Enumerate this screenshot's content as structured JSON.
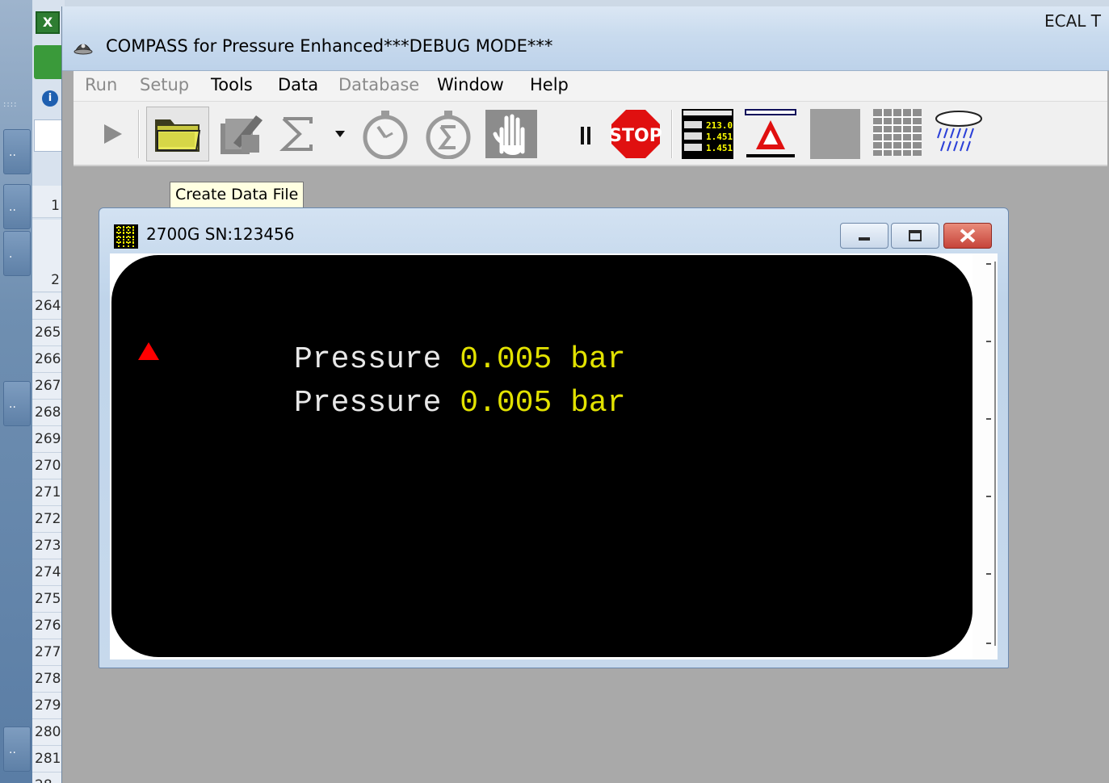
{
  "background_app": {
    "excel_icon_letter": "X",
    "info_icon": "info-icon",
    "title_fragment": "ECAL T",
    "row_headers": [
      "1",
      "2",
      "264",
      "265",
      "266",
      "267",
      "268",
      "269",
      "270",
      "271",
      "272",
      "273",
      "274",
      "275",
      "276",
      "277",
      "278",
      "279",
      "280",
      "281",
      "28"
    ]
  },
  "app": {
    "title": "COMPASS for Pressure Enhanced***DEBUG MODE***",
    "title_icon": "compass-app-icon"
  },
  "menu": [
    {
      "label": "Run",
      "enabled": false
    },
    {
      "label": "Setup",
      "enabled": false
    },
    {
      "label": "Tools",
      "enabled": true
    },
    {
      "label": "Data",
      "enabled": true
    },
    {
      "label": "Database",
      "enabled": false
    },
    {
      "label": "Window",
      "enabled": true
    },
    {
      "label": "Help",
      "enabled": true
    }
  ],
  "toolbar": {
    "items": [
      "run-play-icon",
      "open-folder-icon",
      "edit-document-icon",
      "sigma-icon",
      "dropdown-arrow-icon",
      "stopwatch-icon",
      "stopwatch-sum-icon",
      "hand-stop-icon",
      "pause-icon",
      "stop-sign-icon",
      "readout-display-icon",
      "alarm-triangle-icon",
      "gray-block-icon",
      "grid-icon",
      "rain-cloud-icon"
    ],
    "stop_label": "STOP",
    "readout_icon_values": [
      "213.0",
      "1.451",
      "1.451"
    ]
  },
  "tooltip": {
    "text": "Create Data File"
  },
  "child_window": {
    "title": "2700G SN:123456",
    "title_icon": "device-grid-icon"
  },
  "display": {
    "readings": [
      {
        "label": "Pressure",
        "value": "0.005",
        "unit": "bar"
      },
      {
        "label": "Pressure",
        "value": "0.005",
        "unit": "bar"
      }
    ],
    "indicator_color": "#ff0000",
    "value_color": "#e2e200"
  }
}
